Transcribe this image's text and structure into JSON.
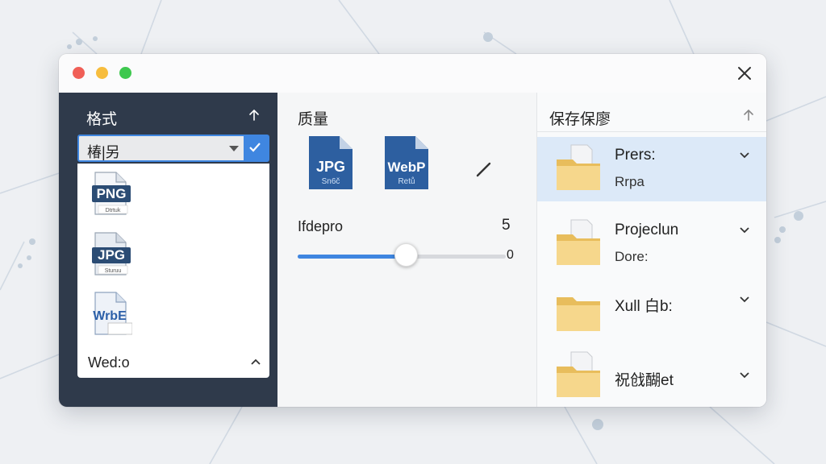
{
  "left_panel": {
    "title": "格式",
    "dropdown_value": "椿|另",
    "formats": [
      {
        "label": "PNG",
        "sub": "Dtrtuk",
        "color": "#2b4c74"
      },
      {
        "label": "JPG",
        "sub": "Sturuu",
        "color": "#2b4c74"
      },
      {
        "label": "WrbE",
        "sub": "",
        "color": "#2b5fa8"
      }
    ],
    "footer_label": "Wed:o"
  },
  "middle_panel": {
    "title": "质量",
    "icons": [
      {
        "label": "JPG",
        "sub": "Sn6č",
        "color": "#2d5fa0"
      },
      {
        "label": "WebP",
        "sub": "Retů",
        "color": "#2d5fa0"
      }
    ],
    "slider": {
      "label": "Ifdepro",
      "max_label": "5",
      "min_label": "0",
      "value_fraction": 0.52,
      "fill_color": "#3f86e0"
    }
  },
  "right_panel": {
    "title": "保存保廖",
    "rows": [
      {
        "name": "Prers:",
        "sub": "Rrpa",
        "selected": true
      },
      {
        "name": "Projeclun",
        "sub": "Dore:",
        "selected": false
      },
      {
        "name": "Xull 白b:",
        "sub": "",
        "selected": false
      },
      {
        "name": "祝戗醐et",
        "sub": "",
        "selected": false
      }
    ]
  },
  "colors": {
    "accent": "#3f86e0",
    "sidebar": "#2f3a4b",
    "folder": "#f2cf7a"
  }
}
